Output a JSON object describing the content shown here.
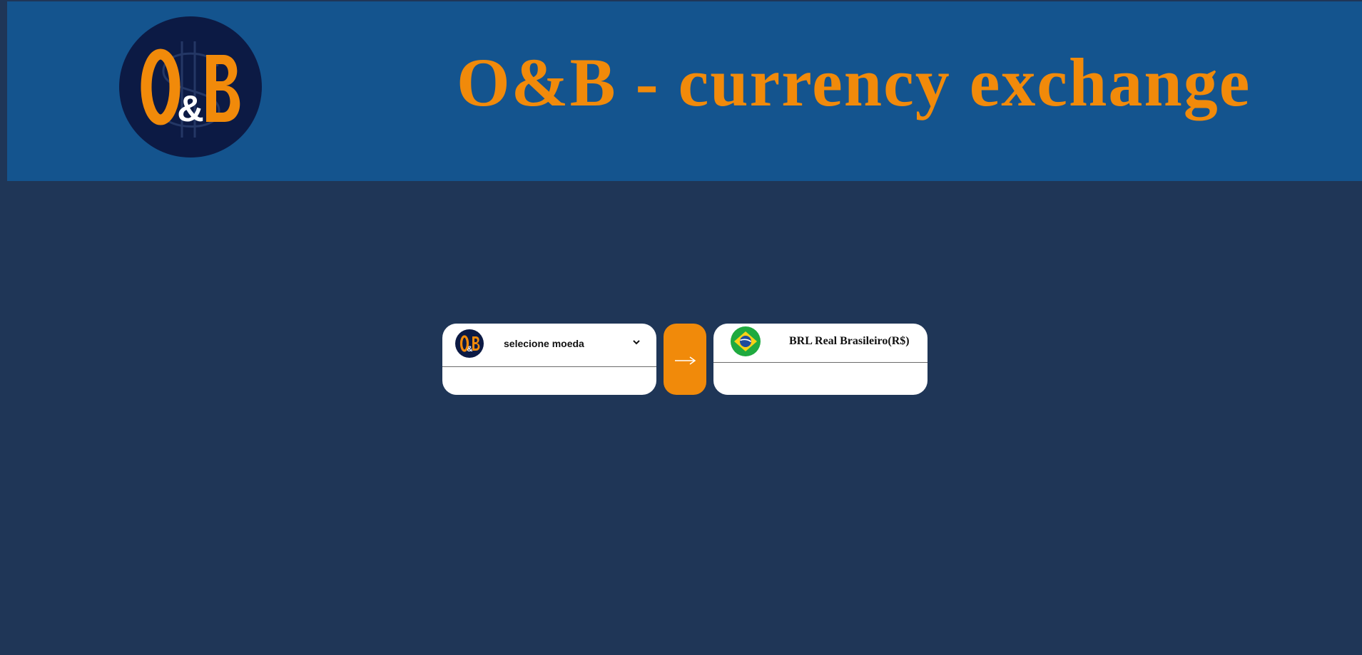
{
  "header": {
    "logo_text": "O&B",
    "title": "O&B - currency exchange"
  },
  "from": {
    "logo_text": "O&B",
    "select_label": "selecione moeda",
    "amount_value": ""
  },
  "convert": {
    "icon": "arrow-right-icon",
    "label": "⟶"
  },
  "to": {
    "flag": "brazil-flag-icon",
    "currency_name": "BRL Real Brasileiro(R$)",
    "amount_value": ""
  },
  "colors": {
    "page_bg": "#1f3657",
    "header_bg": "#14548e",
    "accent": "#f18a0a",
    "logo_bg": "#0c1a44"
  }
}
